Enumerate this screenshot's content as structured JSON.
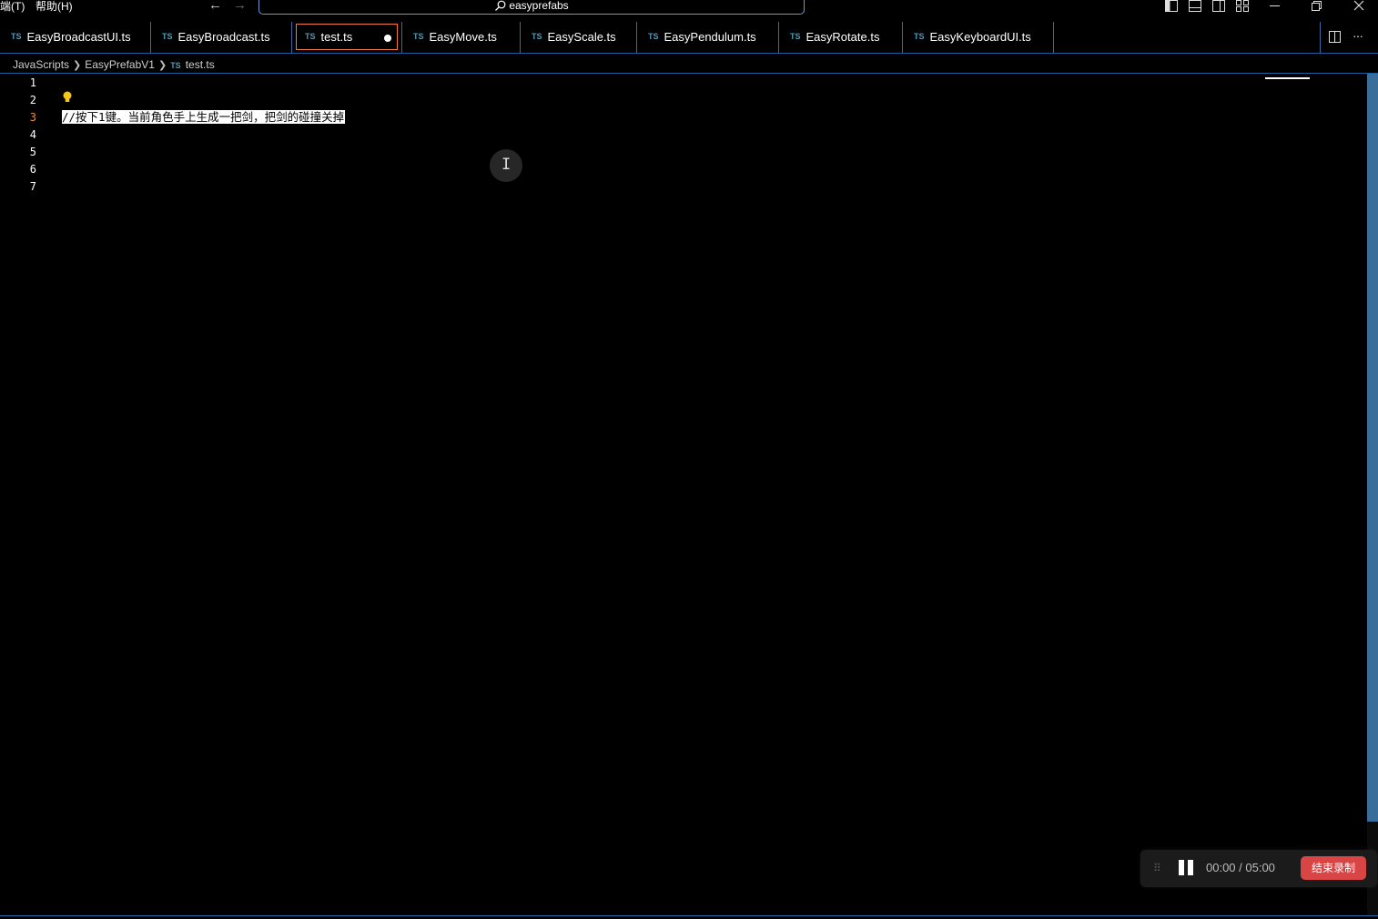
{
  "menus": [
    "端(T)",
    "帮助(H)"
  ],
  "nav": {
    "back_icon": "arrow-left-icon",
    "forward_icon": "arrow-right-icon"
  },
  "search": {
    "text": "easyprefabs",
    "icon": "search-icon"
  },
  "window_controls": [
    "toggle-primary-sidebar-icon",
    "toggle-panel-icon",
    "toggle-secondary-sidebar-icon",
    "customize-layout-icon",
    "minimize-icon",
    "restore-icon",
    "close-icon"
  ],
  "tabs": [
    {
      "badge": "TS",
      "label": "EasyBroadcastUI.ts"
    },
    {
      "badge": "TS",
      "label": "EasyBroadcast.ts"
    },
    {
      "badge": "TS",
      "label": "test.ts",
      "active": true,
      "dirty": true
    },
    {
      "badge": "TS",
      "label": "EasyMove.ts"
    },
    {
      "badge": "TS",
      "label": "EasyScale.ts"
    },
    {
      "badge": "TS",
      "label": "EasyPendulum.ts"
    },
    {
      "badge": "TS",
      "label": "EasyRotate.ts"
    },
    {
      "badge": "TS",
      "label": "EasyKeyboardUI.ts"
    }
  ],
  "tab_actions": {
    "split_icon": "split-editor-icon",
    "more": "···"
  },
  "breadcrumb": {
    "items": [
      "JavaScripts",
      "EasyPrefabV1"
    ],
    "file_badge": "TS",
    "file": "test.ts"
  },
  "editor": {
    "line_numbers": [
      "1",
      "2",
      "3",
      "4",
      "5",
      "6",
      "7"
    ],
    "current_line": "3",
    "code_line_3": "//按下1键。当前角色手上生成一把剑，把剑的碰撞关掉"
  },
  "recorder": {
    "timer": "00:00 / 05:00",
    "stop_label": "结束录制"
  },
  "colors": {
    "accent": "#3d79a8",
    "active_tab_border": "#f07a40",
    "stop_button": "#d94545",
    "current_line_number": "#f28b38"
  }
}
